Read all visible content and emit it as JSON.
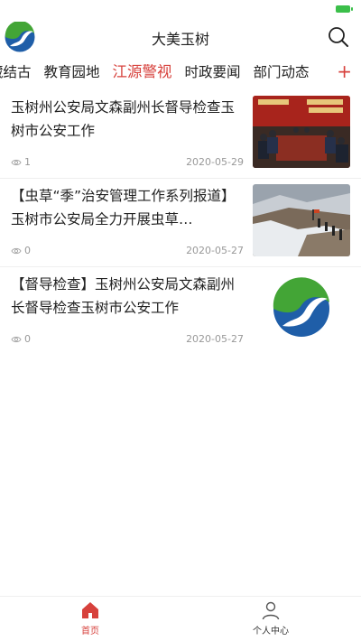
{
  "app": {
    "title": "大美玉树",
    "accent_color": "#d7413c"
  },
  "tabs": [
    {
      "label": "藏结古"
    },
    {
      "label": "教育园地"
    },
    {
      "label": "江源警视",
      "active": true
    },
    {
      "label": "时政要闻"
    },
    {
      "label": "部门动态"
    }
  ],
  "tab_add_label": "+",
  "news": [
    {
      "title": "玉树州公安局文森副州长督导检查玉树市公安工作",
      "views": "1",
      "date": "2020-05-29",
      "thumb": "meeting-photo"
    },
    {
      "title": "【虫草“季”治安管理工作系列报道】玉树市公安局全力开展虫草…",
      "views": "0",
      "date": "2020-05-27",
      "thumb": "mountain-patrol-photo"
    },
    {
      "title": "【督导检查】玉树州公安局文森副州长督导检查玉树市公安工作",
      "views": "0",
      "date": "2020-05-27",
      "thumb": "app-logo"
    }
  ],
  "bottom_nav": [
    {
      "label": "首页",
      "icon": "home-icon",
      "active": true
    },
    {
      "label": "个人中心",
      "icon": "user-icon",
      "active": false
    }
  ]
}
